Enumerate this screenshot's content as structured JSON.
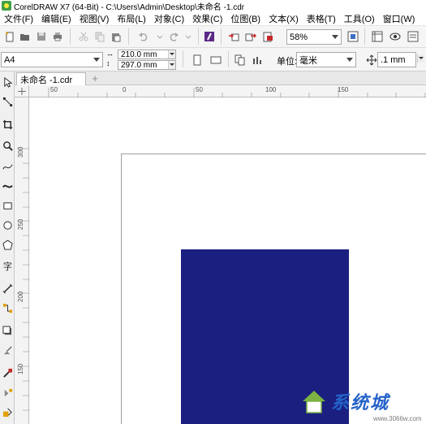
{
  "window": {
    "title": "CorelDRAW X7 (64-Bit) - C:\\Users\\Admin\\Desktop\\未命名 -1.cdr"
  },
  "menu": [
    "文件(F)",
    "编辑(E)",
    "视图(V)",
    "布局(L)",
    "对象(C)",
    "效果(C)",
    "位图(B)",
    "文本(X)",
    "表格(T)",
    "工具(O)",
    "窗口(W)"
  ],
  "toolbar": {
    "zoom_value": "58%",
    "icons": [
      "new-icon",
      "open-icon",
      "save-icon",
      "print-icon",
      "cut-icon",
      "copy-icon",
      "paste-icon",
      "undo-icon",
      "redo-icon",
      "search-content-icon",
      "import-icon",
      "export-icon",
      "publish-pdf-icon",
      "zoom-icon",
      "full-screen-icon",
      "rulers-icon",
      "view-icon",
      "options-icon"
    ]
  },
  "property_bar": {
    "page_size": "A4",
    "width": "210.0 mm",
    "height": "297.0 mm",
    "units_label": "单位:",
    "units_value": "毫米",
    "nudge_value": ".1 mm"
  },
  "document_tab": {
    "name": "未命名 -1.cdr"
  },
  "rulers": {
    "horizontal": [
      "50",
      "0",
      "50",
      "100",
      "150"
    ],
    "vertical": [
      "300",
      "250",
      "200",
      "150"
    ]
  },
  "canvas": {
    "rect_color": "#1b1f80"
  },
  "watermark": {
    "text": "系统城",
    "domain": "www.3066w.com"
  },
  "colors": {
    "accent": "#1b1f80",
    "watermark": "#2563c9"
  }
}
